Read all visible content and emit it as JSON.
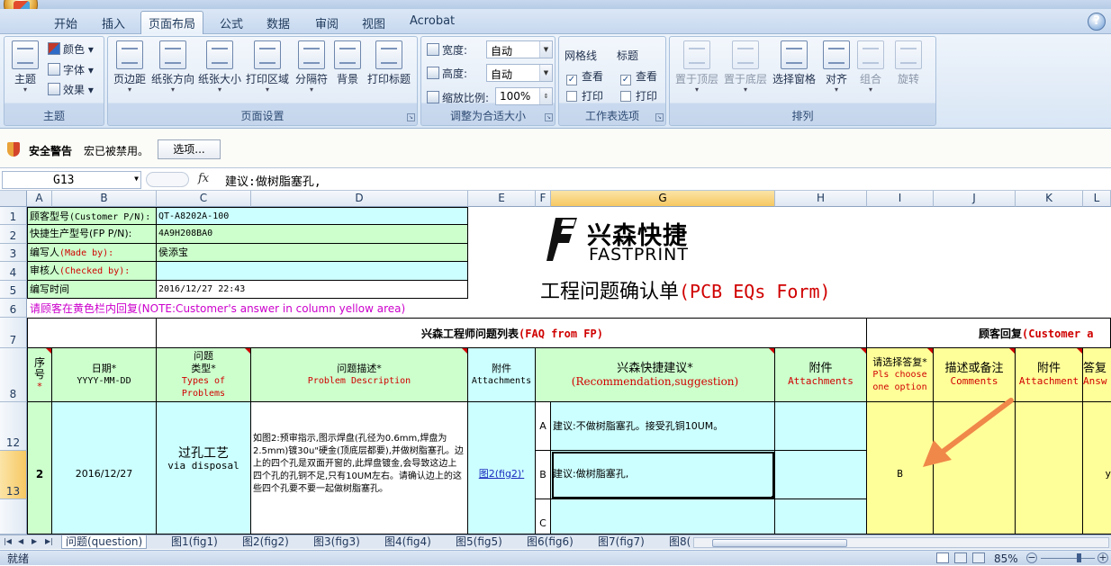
{
  "ribbon_tabs": [
    "开始",
    "插入",
    "页面布局",
    "公式",
    "数据",
    "审阅",
    "视图",
    "Acrobat"
  ],
  "help_icon": "?",
  "ribbon": {
    "theme": {
      "label": "主题",
      "btn": "主题",
      "colors": "颜色",
      "fonts": "字体",
      "effects": "效果"
    },
    "page_setup": {
      "label": "页面设置",
      "margins": "页边距",
      "orientation": "纸张方向",
      "size": "纸张大小",
      "print_area": "打印区域",
      "breaks": "分隔符",
      "background": "背景",
      "print_titles": "打印标题"
    },
    "scale_to_fit": {
      "label": "调整为合适大小",
      "width_label": "宽度:",
      "width_value": "自动",
      "height_label": "高度:",
      "height_value": "自动",
      "scale_label": "缩放比例:",
      "scale_value": "100%"
    },
    "sheet_options": {
      "label": "工作表选项",
      "gridlines": "网格线",
      "headings": "标题",
      "view": "查看",
      "print": "打印"
    },
    "arrange": {
      "label": "排列",
      "bring_front": "置于顶层",
      "send_back": "置于底层",
      "selection_pane": "选择窗格",
      "align": "对齐",
      "group": "组合",
      "rotate": "旋转"
    }
  },
  "security": {
    "title": "安全警告",
    "message": "宏已被禁用。",
    "options_button": "选项..."
  },
  "formula_bar": {
    "name_box": "G13",
    "fx": "fx",
    "value": "建议:做树脂塞孔,"
  },
  "columns": [
    "A",
    "B",
    "C",
    "D",
    "E",
    "F",
    "G",
    "H",
    "I",
    "J",
    "K",
    "L"
  ],
  "rows": [
    "1",
    "2",
    "3",
    "4",
    "5",
    "6",
    "7",
    "8",
    "12",
    "13"
  ],
  "sheet": {
    "labels": {
      "r1": "顾客型号",
      "r1en": "(Customer P/N):",
      "r2": "快捷生产型号(FP P/N):",
      "r3": "编写人",
      "r3en": "(Made by):",
      "r4": "审核人",
      "r4en": "(Checked by):",
      "r5": "编写时间"
    },
    "values": {
      "customer_pn": "QT-A8202A-100",
      "fp_pn": "4A9H208BA0",
      "made_by": "侯添宝",
      "checked_by": "",
      "date_written": "2016/12/27 22:43"
    },
    "logo_cn": "兴森快捷",
    "logo_en": "FASTPRINT",
    "form_title_cn": "工程问题确认单",
    "form_title_en": "(PCB EQs Form)",
    "notice": "请顾客在黄色栏内回复(NOTE:Customer's answer in column yellow area)",
    "fp_section_cn": "兴森工程师问题列表",
    "fp_section_en": "(FAQ from FP)",
    "cust_section_cn": "顾客回复",
    "cust_section_en": "(Customer a",
    "headers": {
      "seq_cn": "序号",
      "date_cn": "日期*",
      "date_en": "YYYY-MM-DD",
      "type_cn1": "问题",
      "type_cn2": "类型*",
      "type_en1": "Types of",
      "type_en2": "Problems",
      "desc_cn": "问题描述*",
      "desc_en": "Problem Description",
      "att_cn": "附件",
      "att_en": "Attachments",
      "rec_cn": "兴森快捷建议*",
      "rec_en": "(Recommendation,suggestion)",
      "att2_cn": "附件",
      "att2_en": "Attachments",
      "choose_cn": "请选择答复*",
      "choose_en1": "Pls choose",
      "choose_en2": "one option",
      "comments_cn": "描述或备注",
      "comments_en": "Comments",
      "att3_cn": "附件",
      "att3_en": "Attachment",
      "answer_cn": "答复",
      "answer_en": "Answ"
    },
    "item": {
      "seq": "2",
      "date": "2016/12/27",
      "type_cn": "过孔工艺",
      "type_en": "via disposal",
      "description": "如图2:预审指示,图示焊盘(孔径为0.6mm,焊盘为2.5mm)镀30u\"硬金(顶底层都要),并做树脂塞孔。边上的四个孔是双面开窗的,此焊盘镀金,会导致这边上四个孔的孔铜不足,只有10UM左右。请确认边上的这些四个孔要不要一起做树脂塞孔。",
      "attachment_link": "图2(fig2)'",
      "option_a_letter": "A",
      "option_a": "建议:不做树脂塞孔。接受孔铜10UM。",
      "option_b_letter": "B",
      "option_b": "建议:做树脂塞孔,",
      "option_c_letter": "C",
      "selected_answer": "B",
      "answer_partial": "y"
    }
  },
  "sheet_tabs": [
    "问题(question)",
    "图1(fig1)",
    "图2(fig2)",
    "图3(fig3)",
    "图4(fig4)",
    "图5(fig5)",
    "图6(fig6)",
    "图7(fig7)",
    "图8("
  ],
  "status": {
    "ready": "就绪",
    "zoom": "85%"
  },
  "colors": {
    "green": "#ccffcc",
    "cyan": "#ccffff",
    "yellow": "#ffff99",
    "annotation_arrow": "#f0884a",
    "required_red": "#d00000"
  }
}
